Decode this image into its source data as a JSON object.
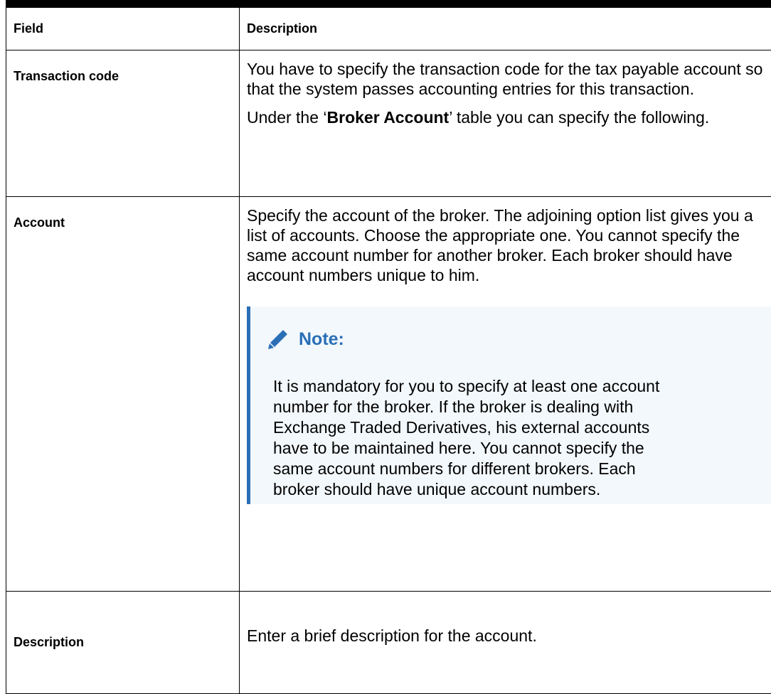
{
  "table": {
    "header": {
      "field": "Field",
      "description": "Description"
    },
    "rows": [
      {
        "field": "Transaction code",
        "desc_p1": "You have to specify the transaction code for the tax payable account so that the system passes accounting entries for this transaction.",
        "desc_p2_before": "Under the ‘",
        "desc_p2_bold": "Broker Account",
        "desc_p2_after": "’ table you can specify the following."
      },
      {
        "field": "Account",
        "desc_p1": "Specify the account of the broker. The adjoining option list gives you a list of accounts. Choose the appropriate one. You cannot specify the same account number for another broker. Each broker should have account numbers unique to him.",
        "note": {
          "icon": "pencil-icon",
          "title": "Note:",
          "body": "It is mandatory for you to specify at least one account number for the broker. If the broker is dealing with Exchange Traded Derivatives, his external accounts have to be maintained here. You cannot specify the same account numbers for different brokers. Each broker should have unique account numbers."
        }
      },
      {
        "field": "Description",
        "desc_p1": "Enter a brief description for the account."
      }
    ]
  },
  "colors": {
    "note_accent": "#2a6fb6",
    "note_background": "#f3f8fc",
    "text": "#000000"
  }
}
